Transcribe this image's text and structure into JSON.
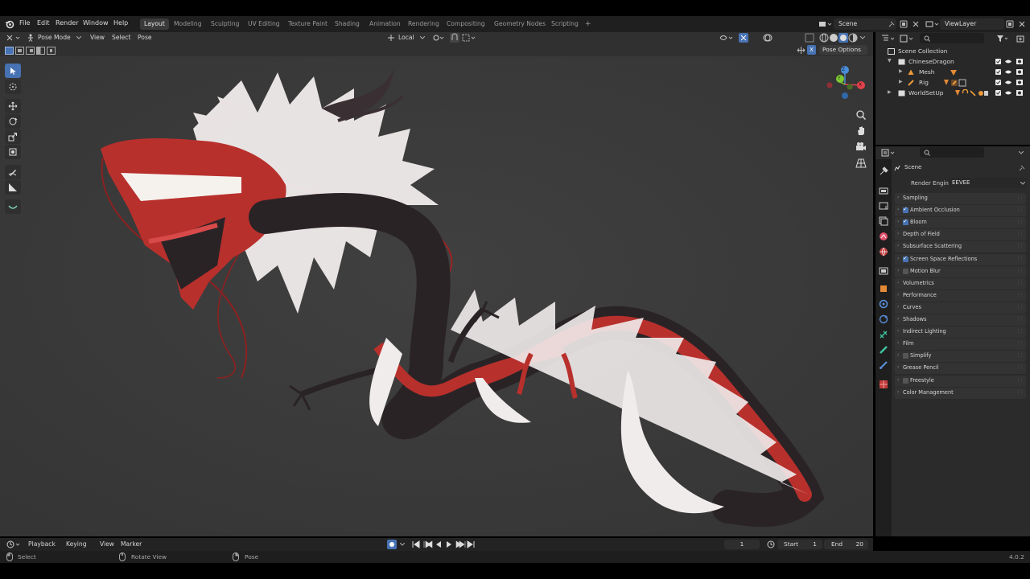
{
  "top_menu": [
    "File",
    "Edit",
    "Render",
    "Window",
    "Help"
  ],
  "workspace_tabs": [
    "Layout",
    "Modeling",
    "Sculpting",
    "UV Editing",
    "Texture Paint",
    "Shading",
    "Animation",
    "Rendering",
    "Compositing",
    "Geometry Nodes",
    "Scripting"
  ],
  "active_workspace": "Layout",
  "add_tab": "+",
  "scene": "Scene",
  "view_layer": "ViewLayer",
  "viewport_header": {
    "mode": "Pose Mode",
    "menus": [
      "View",
      "Select",
      "Pose"
    ],
    "orientation": "Local",
    "pose_options": "Pose Options",
    "x_axis": "X"
  },
  "gizmo": {
    "x": "X",
    "y": "Y",
    "z": "Z"
  },
  "outliner": {
    "root": "Scene Collection",
    "items": [
      {
        "label": "ChineseDragon"
      },
      {
        "label": "Mesh"
      },
      {
        "label": "Rig"
      },
      {
        "label": "WorldSetUp"
      }
    ]
  },
  "properties": {
    "context": "Scene",
    "render_engine_label": "Render Engine",
    "render_engine_value": "EEVEE",
    "panels": [
      {
        "label": "Sampling",
        "checkbox": null
      },
      {
        "label": "Ambient Occlusion",
        "checkbox": true
      },
      {
        "label": "Bloom",
        "checkbox": true
      },
      {
        "label": "Depth of Field",
        "checkbox": null
      },
      {
        "label": "Subsurface Scattering",
        "checkbox": null
      },
      {
        "label": "Screen Space Reflections",
        "checkbox": true
      },
      {
        "label": "Motion Blur",
        "checkbox": false
      },
      {
        "label": "Volumetrics",
        "checkbox": null
      },
      {
        "label": "Performance",
        "checkbox": null
      },
      {
        "label": "Curves",
        "checkbox": null
      },
      {
        "label": "Shadows",
        "checkbox": null
      },
      {
        "label": "Indirect Lighting",
        "checkbox": null
      },
      {
        "label": "Film",
        "checkbox": null
      },
      {
        "label": "Simplify",
        "checkbox": false
      },
      {
        "label": "Grease Pencil",
        "checkbox": null
      },
      {
        "label": "Freestyle",
        "checkbox": false
      },
      {
        "label": "Color Management",
        "checkbox": null
      }
    ]
  },
  "timeline": {
    "menus": [
      "Playback",
      "Keying",
      "View",
      "Marker"
    ],
    "current_frame": "1",
    "start_label": "Start",
    "start_value": "1",
    "end_label": "End",
    "end_value": "20"
  },
  "statusbar": {
    "select": "Select",
    "rotate": "Rotate View",
    "pose": "Pose",
    "version": "4.0.2"
  },
  "colors": {
    "accent": "#4772b3",
    "viewport_bg": "#3b3b3b",
    "dragon_red": "#b8302c",
    "dragon_dark": "#2a2326",
    "mane_white": "#f1ecec"
  }
}
